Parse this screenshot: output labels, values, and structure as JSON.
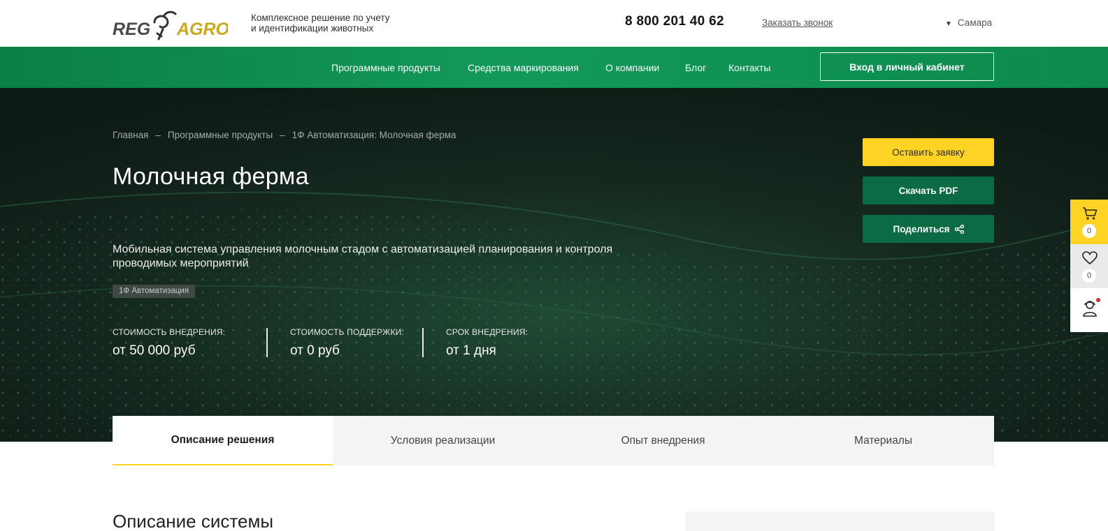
{
  "header": {
    "logo_text": "REG AGRO",
    "tagline_line1": "Комплексное решение по учету",
    "tagline_line2": "и идентификации животных",
    "phone": "8 800 201 40 62",
    "callback_label": "Заказать звонок",
    "city": "Самара",
    "logo_colors": {
      "reg": "#4a4a4a",
      "agro": "#c9a91a"
    }
  },
  "nav": {
    "items": [
      {
        "label": "Программные продукты"
      },
      {
        "label": "Средства маркирования"
      },
      {
        "label": "О компании"
      },
      {
        "label": "Блог"
      },
      {
        "label": "Контакты"
      }
    ],
    "login_label": "Вход в личный кабинет"
  },
  "hero": {
    "breadcrumb": [
      "Главная",
      "Программные продукты",
      "1Ф Автоматизация: Молочная ферма"
    ],
    "title": "Молочная ферма",
    "subtitle": "Мобильная система управления молочным стадом с автоматизацией планирования и контроля проводимых мероприятий",
    "tag": "1Ф Автоматизация",
    "metrics": [
      {
        "label": "Стоимость внедрения:",
        "value": "от 50 000 руб"
      },
      {
        "label": "Стоимость поддержки:",
        "value": "от 0 руб"
      },
      {
        "label": "Срок внедрения:",
        "value": "от 1 дня"
      }
    ]
  },
  "actions": {
    "request_label": "Оставить заявку",
    "pdf_label": "Скачать PDF",
    "share_label": "Поделиться"
  },
  "side_panel": {
    "cart_count": "0",
    "favorites_count": "0",
    "icons": [
      "cart-icon",
      "heart-icon",
      "support-agent-icon"
    ]
  },
  "tabs": [
    {
      "label": "Описание решения",
      "active": true
    },
    {
      "label": "Условия реализации",
      "active": false
    },
    {
      "label": "Опыт внедрения",
      "active": false
    },
    {
      "label": "Материалы",
      "active": false
    }
  ],
  "content": {
    "section_title": "Описание системы"
  },
  "colors": {
    "nav_green": "#0b8a4c",
    "button_green": "#0a6b45",
    "accent_yellow": "#ffd324",
    "hero_dark": "#101d18"
  }
}
